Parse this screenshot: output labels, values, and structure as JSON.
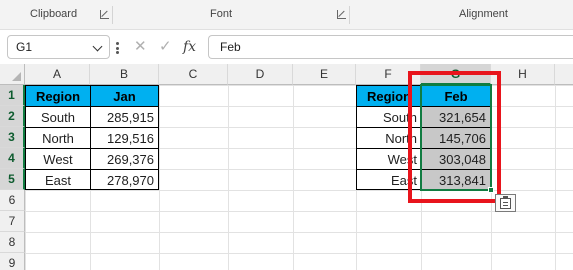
{
  "ribbon": {
    "groups": [
      "Clipboard",
      "Font",
      "Alignment"
    ]
  },
  "formula_bar": {
    "name_box": "G1",
    "formula": "Feb",
    "icons": [
      "cancel-x-icon",
      "enter-check-icon",
      "insert-function-icon"
    ]
  },
  "sheet": {
    "columns": [
      "A",
      "B",
      "C",
      "D",
      "E",
      "F",
      "G",
      "H"
    ],
    "rows": [
      "1",
      "2",
      "3",
      "4",
      "5",
      "6",
      "7",
      "8",
      "9"
    ],
    "selected_column": "G",
    "selected_rows": [
      "1",
      "2",
      "3",
      "4",
      "5"
    ]
  },
  "table_left": {
    "headers": [
      "Region",
      "Jan"
    ],
    "rows": [
      [
        "South",
        "285,915"
      ],
      [
        "North",
        "129,516"
      ],
      [
        "West",
        "269,376"
      ],
      [
        "East",
        "278,970"
      ]
    ]
  },
  "table_right": {
    "headers": [
      "Region",
      "Feb"
    ],
    "rows": [
      [
        "South",
        "321,654"
      ],
      [
        "North",
        "145,706"
      ],
      [
        "West",
        "303,048"
      ],
      [
        "East",
        "313,841"
      ]
    ]
  },
  "colors": {
    "header_fill": "#00b0f0",
    "selection_green": "#107c41",
    "highlight_red": "#e8141c",
    "selected_fill": "#c8c8c8"
  }
}
